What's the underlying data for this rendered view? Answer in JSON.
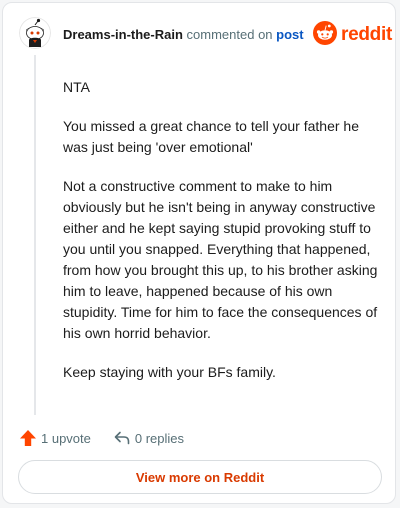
{
  "header": {
    "username": "Dreams-in-the-Rain",
    "commented_on": "commented on",
    "post_link": "post",
    "brand": "reddit"
  },
  "comment": {
    "paragraphs": [
      "NTA",
      "You missed a great chance to tell your father he was just being 'over emotional'",
      "Not a constructive comment to make to him obviously but he isn't being in anyway constructive either and he kept saying stupid provoking stuff to you until you snapped. Everything that happened, from how you brought this up, to his brother asking him to leave, happened because of his own stupidity. Time for him to face the consequences of his own horrid behavior.",
      "Keep staying with your BFs family."
    ]
  },
  "actions": {
    "upvote_label": "1 upvote",
    "replies_label": "0 replies"
  },
  "footer": {
    "view_more_label": "View more on Reddit"
  },
  "colors": {
    "brand": "#ff4500",
    "link": "#0a57c2",
    "upvote": "#ff4500",
    "view_more_text": "#d93a00"
  },
  "icons": {
    "avatar": "snoo-avatar-icon",
    "logo": "reddit-logo-icon",
    "upvote": "upvote-arrow-icon",
    "reply": "reply-arrow-icon"
  }
}
